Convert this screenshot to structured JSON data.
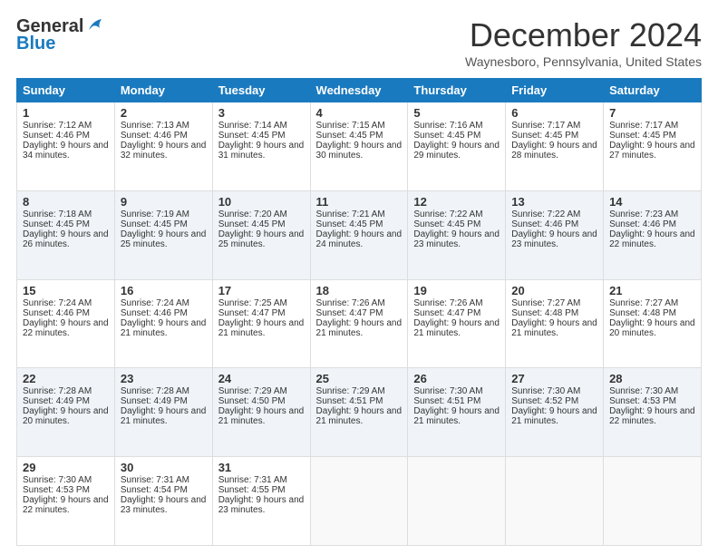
{
  "logo": {
    "line1": "General",
    "line2": "Blue",
    "tagline": ""
  },
  "header": {
    "month": "December 2024",
    "location": "Waynesboro, Pennsylvania, United States"
  },
  "days": [
    "Sunday",
    "Monday",
    "Tuesday",
    "Wednesday",
    "Thursday",
    "Friday",
    "Saturday"
  ],
  "weeks": [
    [
      {
        "day": 1,
        "sunrise": "7:12 AM",
        "sunset": "4:46 PM",
        "daylight": "9 hours and 34 minutes."
      },
      {
        "day": 2,
        "sunrise": "7:13 AM",
        "sunset": "4:46 PM",
        "daylight": "9 hours and 32 minutes."
      },
      {
        "day": 3,
        "sunrise": "7:14 AM",
        "sunset": "4:45 PM",
        "daylight": "9 hours and 31 minutes."
      },
      {
        "day": 4,
        "sunrise": "7:15 AM",
        "sunset": "4:45 PM",
        "daylight": "9 hours and 30 minutes."
      },
      {
        "day": 5,
        "sunrise": "7:16 AM",
        "sunset": "4:45 PM",
        "daylight": "9 hours and 29 minutes."
      },
      {
        "day": 6,
        "sunrise": "7:17 AM",
        "sunset": "4:45 PM",
        "daylight": "9 hours and 28 minutes."
      },
      {
        "day": 7,
        "sunrise": "7:17 AM",
        "sunset": "4:45 PM",
        "daylight": "9 hours and 27 minutes."
      }
    ],
    [
      {
        "day": 8,
        "sunrise": "7:18 AM",
        "sunset": "4:45 PM",
        "daylight": "9 hours and 26 minutes."
      },
      {
        "day": 9,
        "sunrise": "7:19 AM",
        "sunset": "4:45 PM",
        "daylight": "9 hours and 25 minutes."
      },
      {
        "day": 10,
        "sunrise": "7:20 AM",
        "sunset": "4:45 PM",
        "daylight": "9 hours and 25 minutes."
      },
      {
        "day": 11,
        "sunrise": "7:21 AM",
        "sunset": "4:45 PM",
        "daylight": "9 hours and 24 minutes."
      },
      {
        "day": 12,
        "sunrise": "7:22 AM",
        "sunset": "4:45 PM",
        "daylight": "9 hours and 23 minutes."
      },
      {
        "day": 13,
        "sunrise": "7:22 AM",
        "sunset": "4:46 PM",
        "daylight": "9 hours and 23 minutes."
      },
      {
        "day": 14,
        "sunrise": "7:23 AM",
        "sunset": "4:46 PM",
        "daylight": "9 hours and 22 minutes."
      }
    ],
    [
      {
        "day": 15,
        "sunrise": "7:24 AM",
        "sunset": "4:46 PM",
        "daylight": "9 hours and 22 minutes."
      },
      {
        "day": 16,
        "sunrise": "7:24 AM",
        "sunset": "4:46 PM",
        "daylight": "9 hours and 21 minutes."
      },
      {
        "day": 17,
        "sunrise": "7:25 AM",
        "sunset": "4:47 PM",
        "daylight": "9 hours and 21 minutes."
      },
      {
        "day": 18,
        "sunrise": "7:26 AM",
        "sunset": "4:47 PM",
        "daylight": "9 hours and 21 minutes."
      },
      {
        "day": 19,
        "sunrise": "7:26 AM",
        "sunset": "4:47 PM",
        "daylight": "9 hours and 21 minutes."
      },
      {
        "day": 20,
        "sunrise": "7:27 AM",
        "sunset": "4:48 PM",
        "daylight": "9 hours and 21 minutes."
      },
      {
        "day": 21,
        "sunrise": "7:27 AM",
        "sunset": "4:48 PM",
        "daylight": "9 hours and 20 minutes."
      }
    ],
    [
      {
        "day": 22,
        "sunrise": "7:28 AM",
        "sunset": "4:49 PM",
        "daylight": "9 hours and 20 minutes."
      },
      {
        "day": 23,
        "sunrise": "7:28 AM",
        "sunset": "4:49 PM",
        "daylight": "9 hours and 21 minutes."
      },
      {
        "day": 24,
        "sunrise": "7:29 AM",
        "sunset": "4:50 PM",
        "daylight": "9 hours and 21 minutes."
      },
      {
        "day": 25,
        "sunrise": "7:29 AM",
        "sunset": "4:51 PM",
        "daylight": "9 hours and 21 minutes."
      },
      {
        "day": 26,
        "sunrise": "7:30 AM",
        "sunset": "4:51 PM",
        "daylight": "9 hours and 21 minutes."
      },
      {
        "day": 27,
        "sunrise": "7:30 AM",
        "sunset": "4:52 PM",
        "daylight": "9 hours and 21 minutes."
      },
      {
        "day": 28,
        "sunrise": "7:30 AM",
        "sunset": "4:53 PM",
        "daylight": "9 hours and 22 minutes."
      }
    ],
    [
      {
        "day": 29,
        "sunrise": "7:30 AM",
        "sunset": "4:53 PM",
        "daylight": "9 hours and 22 minutes."
      },
      {
        "day": 30,
        "sunrise": "7:31 AM",
        "sunset": "4:54 PM",
        "daylight": "9 hours and 23 minutes."
      },
      {
        "day": 31,
        "sunrise": "7:31 AM",
        "sunset": "4:55 PM",
        "daylight": "9 hours and 23 minutes."
      },
      null,
      null,
      null,
      null
    ]
  ],
  "labels": {
    "sunrise": "Sunrise:",
    "sunset": "Sunset:",
    "daylight": "Daylight:"
  }
}
